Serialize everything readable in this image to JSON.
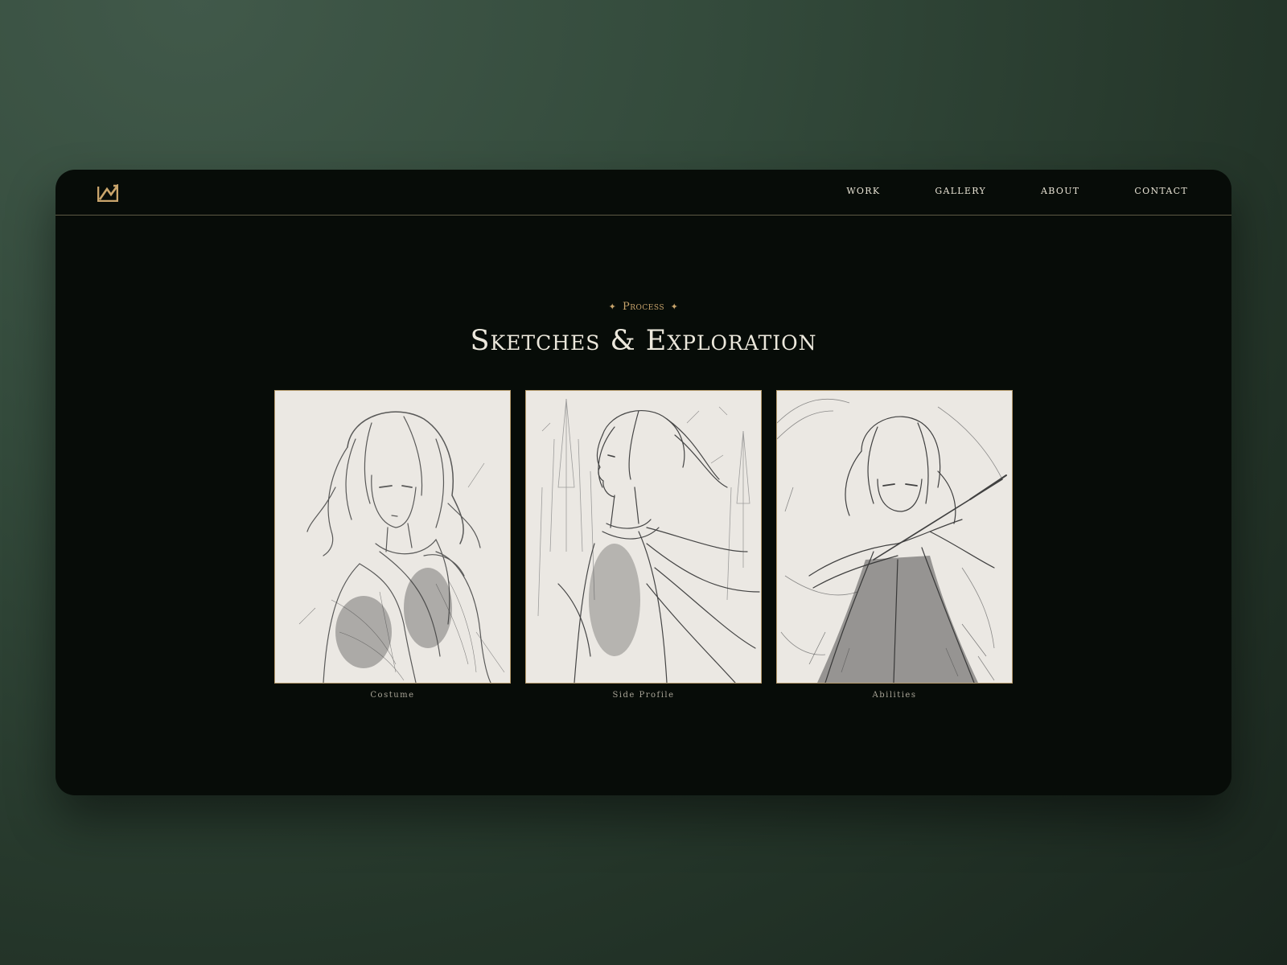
{
  "nav": {
    "logo": "logo-mark-icon",
    "links": [
      "WORK",
      "GALLERY",
      "ABOUT",
      "CONTACT"
    ]
  },
  "section": {
    "eyebrow_star": "✦",
    "eyebrow": "Process",
    "title": "Sketches & Exploration"
  },
  "sketches": [
    {
      "caption": "Costume",
      "image": "pencil sketch of girl in lace gown, three-quarter view"
    },
    {
      "caption": "Side Profile",
      "image": "pencil sketch of girl in side profile with flowing cape and spires"
    },
    {
      "caption": "Abilities",
      "image": "pencil sketch of girl holding a blade with swirling wind"
    }
  ],
  "colors": {
    "accent": "#c9a56c",
    "window_bg": "#070c08",
    "text": "#ece8dc",
    "frame_border": "#b59a6b",
    "paper": "#ebe8e3"
  }
}
